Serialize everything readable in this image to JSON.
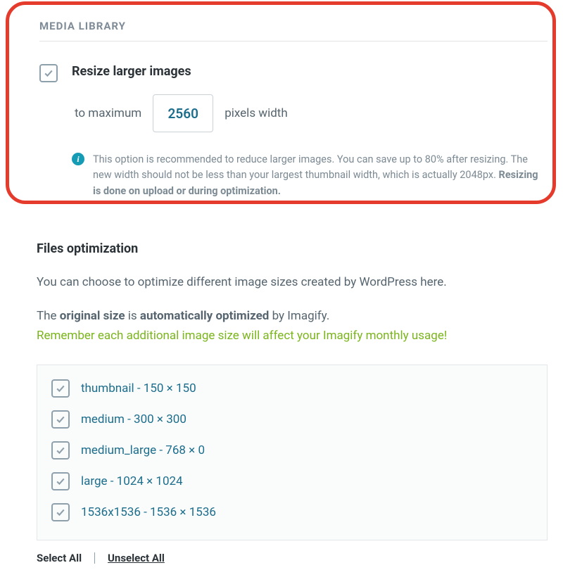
{
  "section_title": "MEDIA LIBRARY",
  "resize": {
    "title": "Resize larger images",
    "to_max": "to maximum",
    "value": "2560",
    "px_width": "pixels width",
    "info_before": "This option is recommended to reduce larger images. You can save up to 80% after resizing. The new width should not be less than your largest thumbnail width, which is actually 2048px. ",
    "info_strong": "Resizing is done on upload or during optimization."
  },
  "files_opt": {
    "title": "Files optimization",
    "desc": "You can choose to optimize different image sizes created by WordPress here.",
    "line2_a": "The ",
    "line2_b": "original size",
    "line2_c": " is ",
    "line2_d": "automatically optimized",
    "line2_e": " by Imagify.",
    "warning": "Remember each additional image size will affect your Imagify monthly usage!"
  },
  "sizes": [
    {
      "label": "thumbnail - 150 × 150"
    },
    {
      "label": "medium - 300 × 300"
    },
    {
      "label": "medium_large - 768 × 0"
    },
    {
      "label": "large - 1024 × 1024"
    },
    {
      "label": "1536x1536 - 1536 × 1536"
    }
  ],
  "actions": {
    "select_all": "Select All",
    "unselect_all": "Unselect All"
  }
}
